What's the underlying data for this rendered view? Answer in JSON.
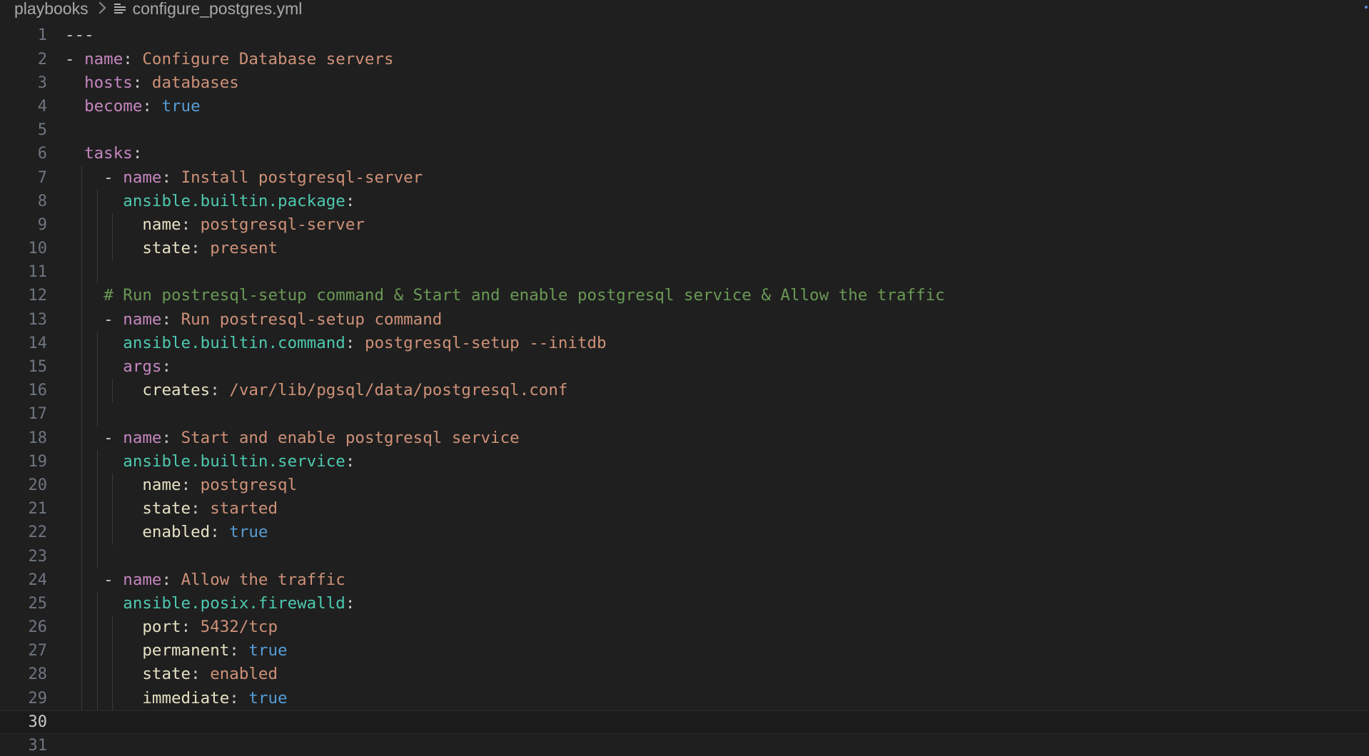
{
  "breadcrumb": {
    "folder": "playbooks",
    "file": "configure_postgres.yml"
  },
  "editor": {
    "current_line": 30,
    "colors": {
      "background": "#1f1f1f",
      "keyword": "#c586c0",
      "module": "#4ec9b0",
      "string": "#ce9178",
      "boolean": "#569cd6",
      "comment": "#6a9955"
    },
    "lines": [
      {
        "n": "1",
        "tokens": [
          {
            "t": "---",
            "c": "punct"
          }
        ]
      },
      {
        "n": "2",
        "tokens": [
          {
            "t": "- ",
            "c": "punct"
          },
          {
            "t": "name",
            "c": "key"
          },
          {
            "t": ": ",
            "c": "punct"
          },
          {
            "t": "Configure Database servers",
            "c": "str"
          }
        ]
      },
      {
        "n": "3",
        "tokens": [
          {
            "t": "  ",
            "c": "punct"
          },
          {
            "t": "hosts",
            "c": "key"
          },
          {
            "t": ": ",
            "c": "punct"
          },
          {
            "t": "databases",
            "c": "str"
          }
        ]
      },
      {
        "n": "4",
        "tokens": [
          {
            "t": "  ",
            "c": "punct"
          },
          {
            "t": "become",
            "c": "key"
          },
          {
            "t": ": ",
            "c": "punct"
          },
          {
            "t": "true",
            "c": "bool"
          }
        ]
      },
      {
        "n": "5",
        "tokens": []
      },
      {
        "n": "6",
        "tokens": [
          {
            "t": "  ",
            "c": "punct"
          },
          {
            "t": "tasks",
            "c": "key"
          },
          {
            "t": ":",
            "c": "punct"
          }
        ]
      },
      {
        "n": "7",
        "tokens": [
          {
            "t": "    - ",
            "c": "punct"
          },
          {
            "t": "name",
            "c": "key"
          },
          {
            "t": ": ",
            "c": "punct"
          },
          {
            "t": "Install postgresql-server",
            "c": "str"
          }
        ]
      },
      {
        "n": "8",
        "tokens": [
          {
            "t": "      ",
            "c": "punct"
          },
          {
            "t": "ansible.builtin.package",
            "c": "mod"
          },
          {
            "t": ":",
            "c": "punct"
          }
        ]
      },
      {
        "n": "9",
        "tokens": [
          {
            "t": "        ",
            "c": "punct"
          },
          {
            "t": "name",
            "c": "prop"
          },
          {
            "t": ": ",
            "c": "punct"
          },
          {
            "t": "postgresql-server",
            "c": "str"
          }
        ]
      },
      {
        "n": "10",
        "tokens": [
          {
            "t": "        ",
            "c": "punct"
          },
          {
            "t": "state",
            "c": "prop"
          },
          {
            "t": ": ",
            "c": "punct"
          },
          {
            "t": "present",
            "c": "str"
          }
        ]
      },
      {
        "n": "11",
        "tokens": []
      },
      {
        "n": "12",
        "tokens": [
          {
            "t": "    ",
            "c": "punct"
          },
          {
            "t": "# Run postresql-setup command & Start and enable postgresql service & Allow the traffic",
            "c": "com"
          }
        ]
      },
      {
        "n": "13",
        "tokens": [
          {
            "t": "    - ",
            "c": "punct"
          },
          {
            "t": "name",
            "c": "key"
          },
          {
            "t": ": ",
            "c": "punct"
          },
          {
            "t": "Run postresql-setup command",
            "c": "str"
          }
        ]
      },
      {
        "n": "14",
        "tokens": [
          {
            "t": "      ",
            "c": "punct"
          },
          {
            "t": "ansible.builtin.command",
            "c": "mod"
          },
          {
            "t": ": ",
            "c": "punct"
          },
          {
            "t": "postgresql-setup --initdb",
            "c": "str"
          }
        ]
      },
      {
        "n": "15",
        "tokens": [
          {
            "t": "      ",
            "c": "punct"
          },
          {
            "t": "args",
            "c": "key"
          },
          {
            "t": ":",
            "c": "punct"
          }
        ]
      },
      {
        "n": "16",
        "tokens": [
          {
            "t": "        ",
            "c": "punct"
          },
          {
            "t": "creates",
            "c": "prop"
          },
          {
            "t": ": ",
            "c": "punct"
          },
          {
            "t": "/var/lib/pgsql/data/postgresql.conf",
            "c": "str"
          }
        ]
      },
      {
        "n": "17",
        "tokens": []
      },
      {
        "n": "18",
        "tokens": [
          {
            "t": "    - ",
            "c": "punct"
          },
          {
            "t": "name",
            "c": "key"
          },
          {
            "t": ": ",
            "c": "punct"
          },
          {
            "t": "Start and enable postgresql service",
            "c": "str"
          }
        ]
      },
      {
        "n": "19",
        "tokens": [
          {
            "t": "      ",
            "c": "punct"
          },
          {
            "t": "ansible.builtin.service",
            "c": "mod"
          },
          {
            "t": ":",
            "c": "punct"
          }
        ]
      },
      {
        "n": "20",
        "tokens": [
          {
            "t": "        ",
            "c": "punct"
          },
          {
            "t": "name",
            "c": "prop"
          },
          {
            "t": ": ",
            "c": "punct"
          },
          {
            "t": "postgresql",
            "c": "str"
          }
        ]
      },
      {
        "n": "21",
        "tokens": [
          {
            "t": "        ",
            "c": "punct"
          },
          {
            "t": "state",
            "c": "prop"
          },
          {
            "t": ": ",
            "c": "punct"
          },
          {
            "t": "started",
            "c": "str"
          }
        ]
      },
      {
        "n": "22",
        "tokens": [
          {
            "t": "        ",
            "c": "punct"
          },
          {
            "t": "enabled",
            "c": "prop"
          },
          {
            "t": ": ",
            "c": "punct"
          },
          {
            "t": "true",
            "c": "bool"
          }
        ]
      },
      {
        "n": "23",
        "tokens": []
      },
      {
        "n": "24",
        "tokens": [
          {
            "t": "    - ",
            "c": "punct"
          },
          {
            "t": "name",
            "c": "key"
          },
          {
            "t": ": ",
            "c": "punct"
          },
          {
            "t": "Allow the traffic",
            "c": "str"
          }
        ]
      },
      {
        "n": "25",
        "tokens": [
          {
            "t": "      ",
            "c": "punct"
          },
          {
            "t": "ansible.posix.firewalld",
            "c": "mod"
          },
          {
            "t": ":",
            "c": "punct"
          }
        ]
      },
      {
        "n": "26",
        "tokens": [
          {
            "t": "        ",
            "c": "punct"
          },
          {
            "t": "port",
            "c": "prop"
          },
          {
            "t": ": ",
            "c": "punct"
          },
          {
            "t": "5432/tcp",
            "c": "str"
          }
        ]
      },
      {
        "n": "27",
        "tokens": [
          {
            "t": "        ",
            "c": "punct"
          },
          {
            "t": "permanent",
            "c": "prop"
          },
          {
            "t": ": ",
            "c": "punct"
          },
          {
            "t": "true",
            "c": "bool"
          }
        ]
      },
      {
        "n": "28",
        "tokens": [
          {
            "t": "        ",
            "c": "punct"
          },
          {
            "t": "state",
            "c": "prop"
          },
          {
            "t": ": ",
            "c": "punct"
          },
          {
            "t": "enabled",
            "c": "str"
          }
        ]
      },
      {
        "n": "29",
        "tokens": [
          {
            "t": "        ",
            "c": "punct"
          },
          {
            "t": "immediate",
            "c": "prop"
          },
          {
            "t": ": ",
            "c": "punct"
          },
          {
            "t": "true",
            "c": "bool"
          }
        ]
      },
      {
        "n": "30",
        "tokens": []
      },
      {
        "n": "31",
        "tokens": []
      }
    ]
  }
}
